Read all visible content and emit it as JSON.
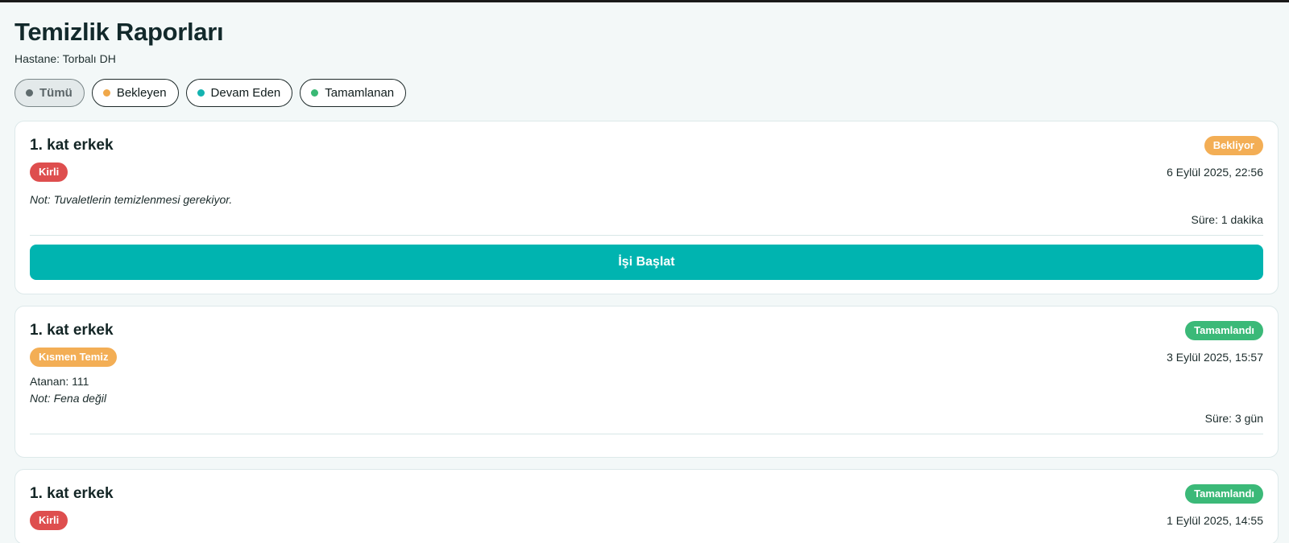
{
  "page": {
    "title": "Temizlik Raporları",
    "subtitle": "Hastane: Torbalı DH"
  },
  "filters": [
    {
      "label": "Tümü",
      "dot_color": "#5f6b6d",
      "active": true
    },
    {
      "label": "Bekleyen",
      "dot_color": "#f0a84a",
      "active": false
    },
    {
      "label": "Devam Eden",
      "dot_color": "#14b3b0",
      "active": false
    },
    {
      "label": "Tamamlanan",
      "dot_color": "#39b874",
      "active": false
    }
  ],
  "reports": [
    {
      "title": "1. kat erkek",
      "status": "Bekliyor",
      "status_color": "#f3ae55",
      "condition": "Kirli",
      "condition_color": "#de4e4e",
      "date": "6 Eylül 2025, 22:56",
      "note": "Not: Tuvaletlerin temizlenmesi gerekiyor.",
      "duration": "Süre: 1 dakika",
      "action_label": "İşi Başlat",
      "action_color": "#00b4b0"
    },
    {
      "title": "1. kat erkek",
      "status": "Tamamlandı",
      "status_color": "#3bb978",
      "condition": "Kısmen Temiz",
      "condition_color": "#f3ae55",
      "date": "3 Eylül 2025, 15:57",
      "assignee": "Atanan: 111",
      "note": "Not: Fena değil",
      "duration": "Süre: 3 gün"
    },
    {
      "title": "1. kat erkek",
      "status": "Tamamlandı",
      "status_color": "#3bb978",
      "condition": "Kirli",
      "condition_color": "#de4e4e",
      "date": "1 Eylül 2025, 14:55"
    }
  ]
}
